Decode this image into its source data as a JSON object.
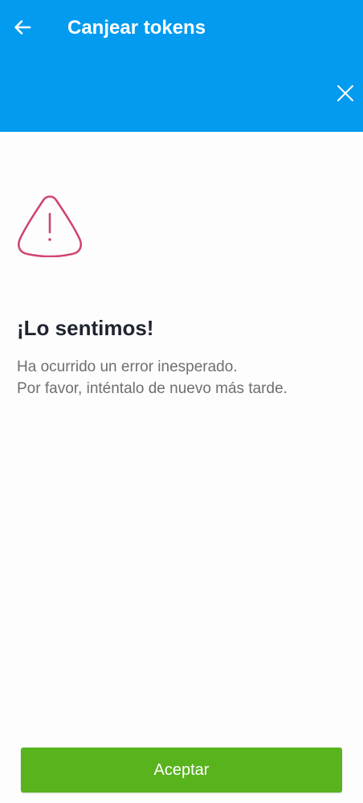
{
  "colors": {
    "app_bar": "#039bf0",
    "accent_button": "#58b31d",
    "warning_icon": "#d0456e",
    "heading_text": "#1f2430",
    "body_text": "#6f6f6f"
  },
  "header": {
    "title": "Canjear tokens",
    "back_icon": "arrow-left-icon",
    "close_icon": "close-icon"
  },
  "error": {
    "icon": "warning-triangle-icon",
    "heading": "¡Lo sentimos!",
    "message_line_1": "Ha ocurrido un error inesperado.",
    "message_line_2": "Por favor, inténtalo de nuevo más tarde."
  },
  "footer": {
    "accept_label": "Aceptar"
  }
}
